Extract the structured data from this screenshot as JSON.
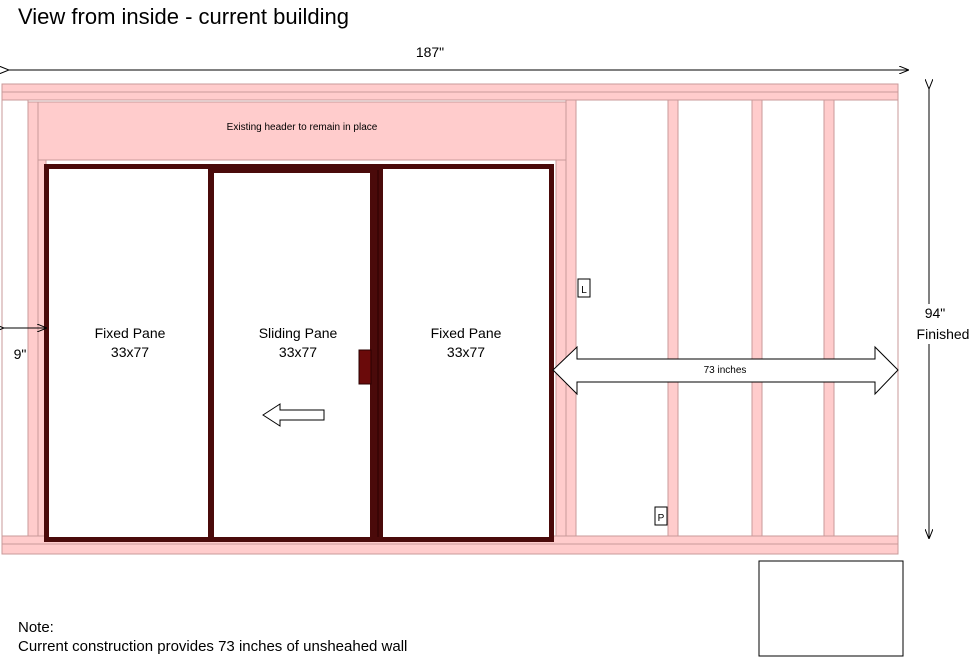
{
  "title": "View from inside - current building",
  "dimensions": {
    "overall_width": "187\"",
    "height_value": "94\"",
    "height_note": "Finished",
    "side_gap": "9\"",
    "unsheathed_span": "73 inches"
  },
  "header_label": "Existing header to remain in place",
  "panes": [
    {
      "name": "Fixed Pane",
      "size": "33x77"
    },
    {
      "name": "Sliding Pane",
      "size": "33x77"
    },
    {
      "name": "Fixed Pane",
      "size": "33x77"
    }
  ],
  "outlets": {
    "light_switch": "L",
    "power_outlet": "P"
  },
  "note": {
    "heading": "Note:",
    "text": "Current construction provides 73 inches of unsheahed wall"
  },
  "colors": {
    "framing_fill": "#ffcccc",
    "framing_stroke": "#c99a9a",
    "door_frame": "#4a0a0a",
    "line": "#000000"
  }
}
